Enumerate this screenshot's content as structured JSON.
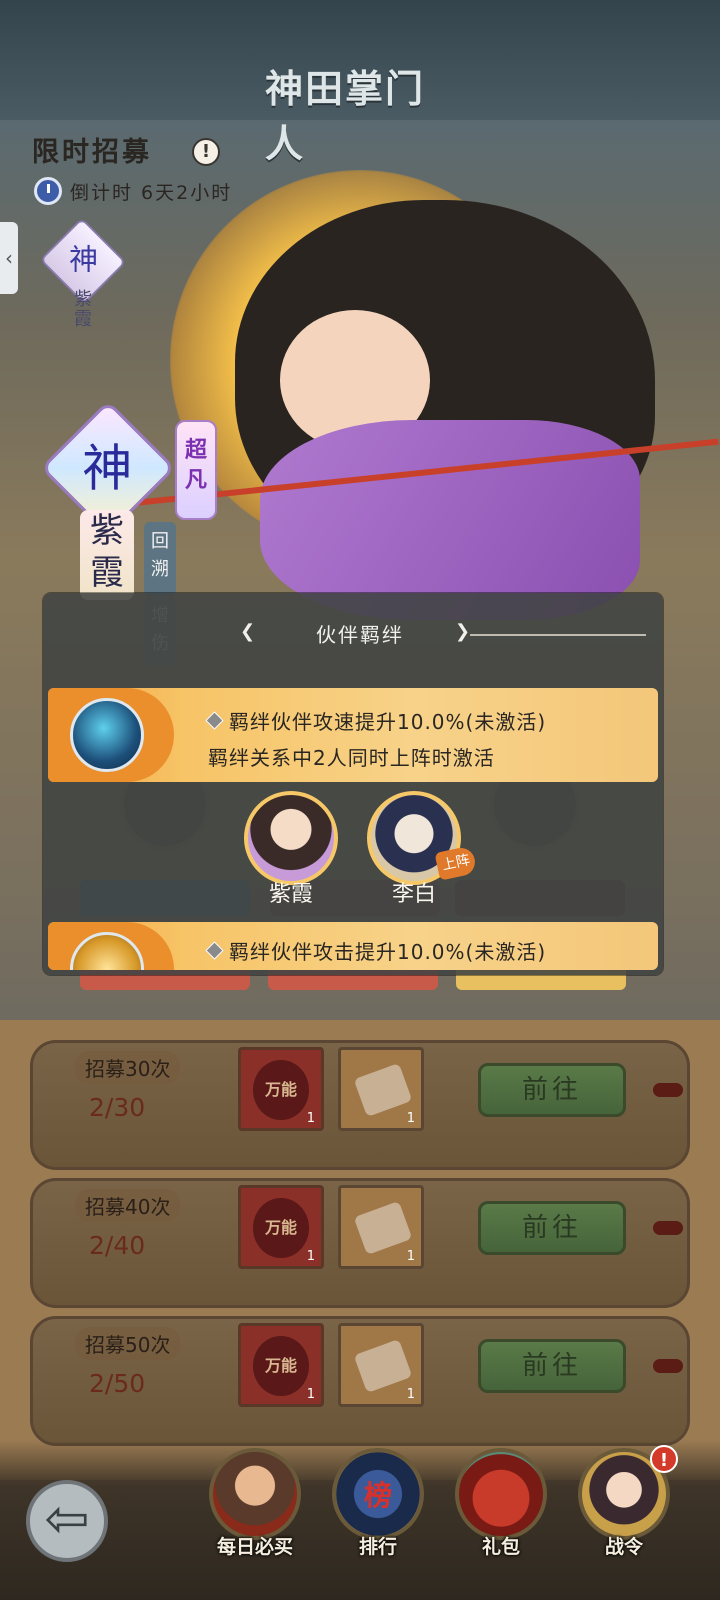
{
  "header": {
    "logo_text": "神田掌门人"
  },
  "recruit": {
    "title": "限时招募",
    "countdown_label": "倒计时",
    "countdown_value": "6天2小时"
  },
  "hero": {
    "grade_small": "神",
    "name_small": "紫霞",
    "grade": "神",
    "rarity": "超凡",
    "name": "紫霞",
    "tag1": "回溯",
    "tag2": "增伤"
  },
  "dialog": {
    "title": "伙伴羁绊",
    "bond1": {
      "effect": "羁绊伙伴攻速提升10.0%(未激活)",
      "condition": "羁绊关系中2人同时上阵时激活"
    },
    "partners": [
      {
        "name": "紫霞",
        "badge": ""
      },
      {
        "name": "李白",
        "badge": "上阵"
      }
    ],
    "bond2": {
      "effect": "羁绊伙伴攻击提升10.0%(未激活)"
    }
  },
  "rewards_rows": [
    {
      "title": "招募30次",
      "progress": "2/30",
      "item1_label": "万能",
      "item1_count": "1",
      "item2_count": "1",
      "button": "前往"
    },
    {
      "title": "招募40次",
      "progress": "2/40",
      "item1_label": "万能",
      "item1_count": "1",
      "item2_count": "1",
      "button": "前往"
    },
    {
      "title": "招募50次",
      "progress": "2/50",
      "item1_label": "万能",
      "item1_count": "1",
      "item2_count": "1",
      "button": "前往"
    }
  ],
  "bottom_nav": {
    "back_icon": "back-arrow-icon",
    "items": [
      {
        "label": "每日必买"
      },
      {
        "label": "排行",
        "sub": "榜"
      },
      {
        "label": "礼包"
      },
      {
        "label": "战令"
      }
    ],
    "badge": "!"
  }
}
